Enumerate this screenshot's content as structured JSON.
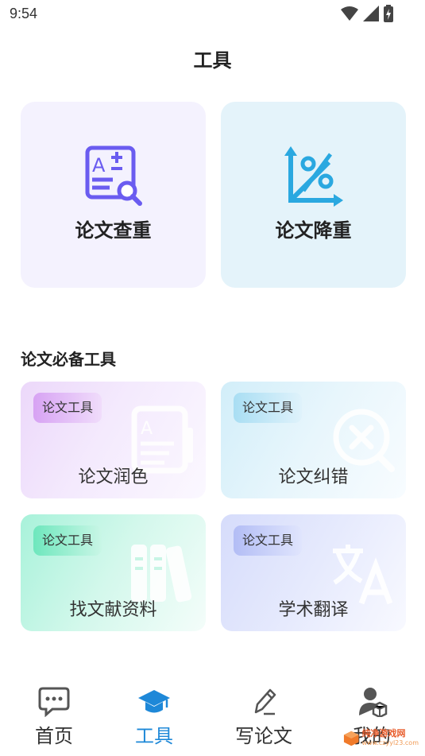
{
  "status": {
    "time": "9:54"
  },
  "header": {
    "title": "工具"
  },
  "feature_cards": [
    {
      "label": "论文查重",
      "icon": "plagiarism-check-icon",
      "accent": "#6a5cf0"
    },
    {
      "label": "论文降重",
      "icon": "percent-reduce-icon",
      "accent": "#2aa8e0"
    }
  ],
  "section": {
    "title": "论文必备工具"
  },
  "tools": [
    {
      "tag": "论文工具",
      "label": "论文润色",
      "icon": "document-icon"
    },
    {
      "tag": "论文工具",
      "label": "论文纠错",
      "icon": "error-magnifier-icon"
    },
    {
      "tag": "论文工具",
      "label": "找文献资料",
      "icon": "books-icon"
    },
    {
      "tag": "论文工具",
      "label": "学术翻译",
      "icon": "translate-icon"
    }
  ],
  "tabbar": {
    "items": [
      {
        "label": "首页",
        "icon": "chat-bubble-icon"
      },
      {
        "label": "工具",
        "icon": "graduation-cap-icon",
        "active": true
      },
      {
        "label": "写论文",
        "icon": "pencil-icon"
      },
      {
        "label": "我的",
        "icon": "user-icon"
      }
    ],
    "active_color": "#1e88d8"
  },
  "watermark": {
    "text": "纯净游戏网",
    "url": "www.czyyl23.com"
  }
}
